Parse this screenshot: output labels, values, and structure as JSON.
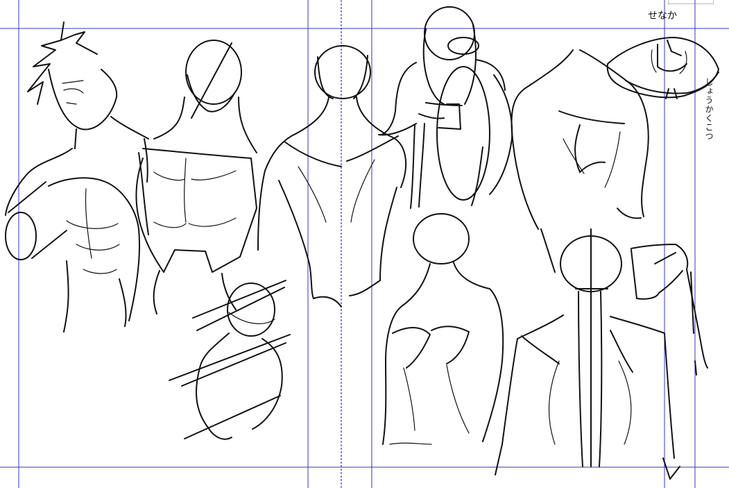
{
  "annotations": {
    "main_note": "せなか",
    "side_note": "しょうかくこつ"
  },
  "guides": {
    "color": "#3a33c8"
  },
  "ink_color": "#111111",
  "figures": [
    "character-torso-sketch",
    "front-torso-sketch",
    "back-torso-sketch",
    "raised-arm-back-sketch",
    "back-muscle-sketch",
    "scapula-top-view-sketch",
    "shoulder-turn-sketch",
    "back-three-quarter-sketch",
    "spine-skeleton-sketch",
    "arm-bone-sketch"
  ]
}
